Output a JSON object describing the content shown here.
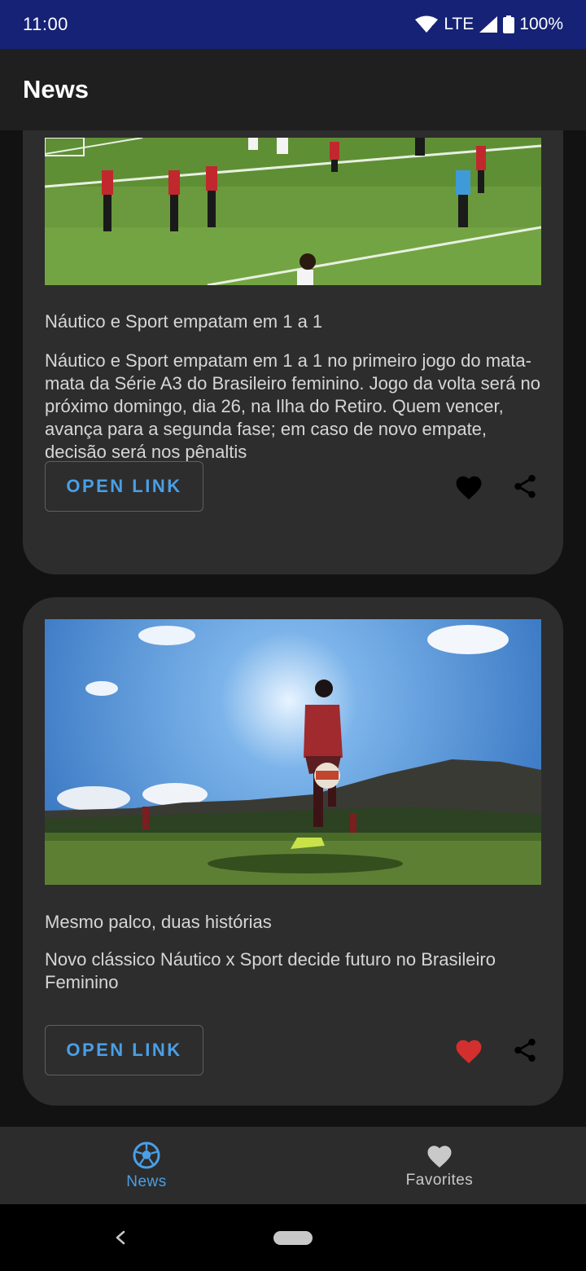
{
  "status_bar": {
    "time": "11:00",
    "network": "LTE",
    "battery": "100%"
  },
  "app_bar": {
    "title": "News"
  },
  "articles": [
    {
      "headline": "Náutico e Sport empatam em 1 a 1",
      "body": "Náutico e Sport empatam em 1 a 1 no primeiro jogo do mata-mata da Série A3 do Brasileiro feminino. Jogo da volta será no próximo domingo, dia 26, na Ilha do Retiro. Quem vencer, avança para a segunda fase; em caso de novo empate, decisão será nos pênaltis",
      "button_label": "OPEN LINK",
      "favorited": false,
      "image": "soccer-match-photo"
    },
    {
      "headline": "Mesmo palco, duas histórias",
      "body": "Novo clássico Náutico x Sport decide futuro no Brasileiro Feminino",
      "button_label": "OPEN LINK",
      "favorited": true,
      "image": "player-juggling-ball-photo"
    }
  ],
  "bottom_nav": {
    "items": [
      {
        "label": "News",
        "icon": "soccer-ball-icon",
        "active": true
      },
      {
        "label": "Favorites",
        "icon": "heart-icon",
        "active": false
      }
    ]
  },
  "colors": {
    "status_bar": "#152275",
    "accent": "#4a9fe6",
    "favorite_active": "#d32f2f",
    "card": "#2d2d2d",
    "background": "#121212"
  }
}
